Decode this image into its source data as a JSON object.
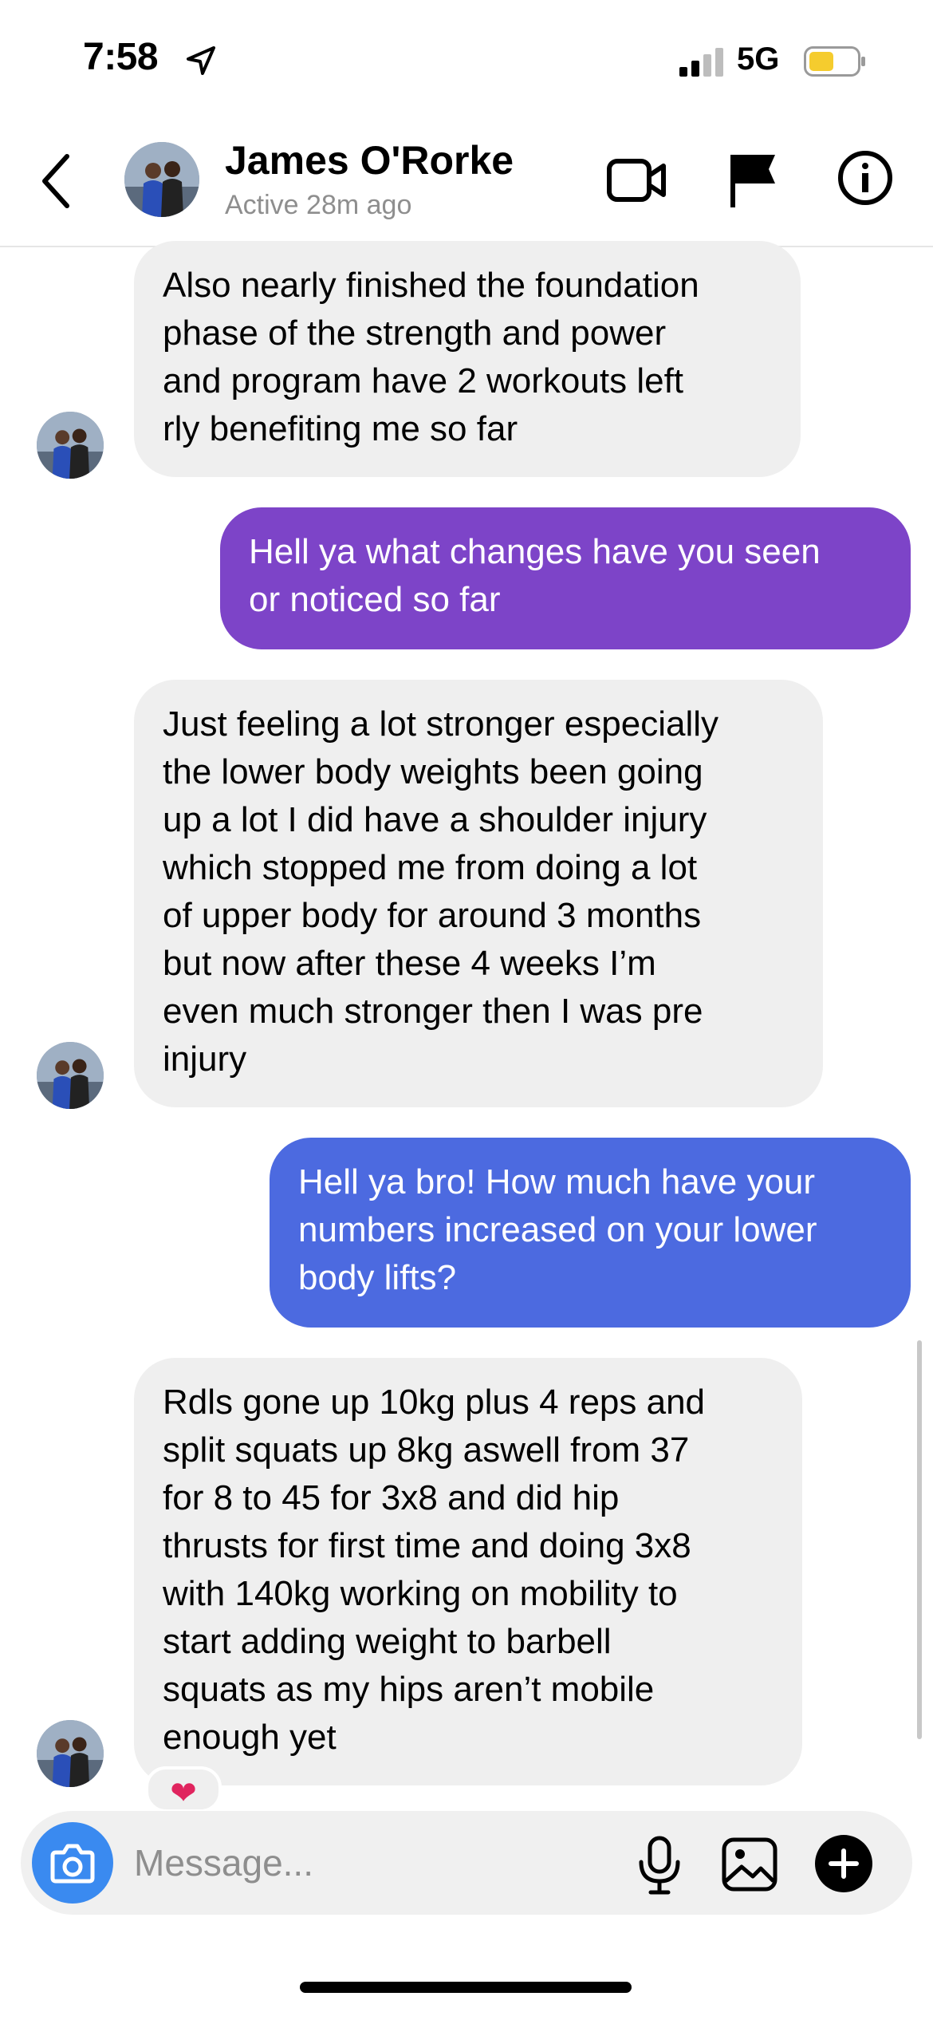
{
  "status_bar": {
    "time": "7:58",
    "network": "5G"
  },
  "header": {
    "name": "James O'Rorke",
    "status": "Active 28m ago"
  },
  "messages": [
    {
      "lines": [
        "Also nearly finished the foundation",
        "phase of the strength and power",
        "and program have 2 workouts left",
        "rly benefiting me so far"
      ]
    },
    {
      "lines": [
        "Hell ya what changes have you seen",
        "or noticed so far"
      ]
    },
    {
      "lines": [
        "Just feeling a lot stronger especially",
        "the lower body weights been going",
        "up a lot I did have a shoulder injury",
        "which stopped me from doing a lot",
        "of upper body for around 3 months",
        "but now after these 4 weeks I’m",
        "even much stronger then I was pre",
        "injury"
      ]
    },
    {
      "lines": [
        "Hell ya bro! How much have your",
        "numbers increased on your lower",
        "body lifts?"
      ]
    },
    {
      "lines": [
        "Rdls gone up 10kg plus 4 reps and",
        "split squats up 8kg aswell from 37",
        "for 8 to 45 for 3x8 and did hip",
        "thrusts for first time and doing 3x8",
        "with 140kg working on mobility to",
        "start adding weight to barbell",
        "squats as my hips aren’t mobile",
        "enough yet"
      ]
    }
  ],
  "reaction": "❤",
  "composer": {
    "placeholder": "Message..."
  },
  "colors": {
    "outgoing_1": "#7d44c8",
    "outgoing_2": "#4c6ae0",
    "incoming": "#efefef",
    "camera": "#3a8af0",
    "battery": "#f5cc2e"
  }
}
